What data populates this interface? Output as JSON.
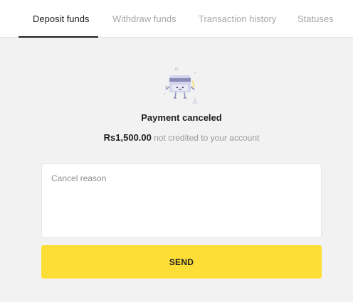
{
  "tabs": [
    {
      "label": "Deposit funds",
      "active": true
    },
    {
      "label": "Withdraw funds",
      "active": false
    },
    {
      "label": "Transaction history",
      "active": false
    },
    {
      "label": "Statuses",
      "active": false
    }
  ],
  "status": {
    "icon": "card-character-icon",
    "title": "Payment canceled",
    "amount": "Rs1,500.00",
    "message": "not credited to your account"
  },
  "cancel_reason": {
    "placeholder": "Cancel reason",
    "value": ""
  },
  "send_button": {
    "label": "SEND"
  },
  "colors": {
    "page_background": "#f2f2f2",
    "accent_yellow": "#fdde36",
    "active_tab_text": "#1f1f1f",
    "inactive_tab_text": "#a7a7a7",
    "muted_text": "#9a9a9a"
  }
}
